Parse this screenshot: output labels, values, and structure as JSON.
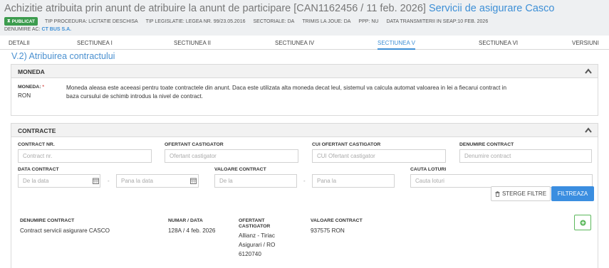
{
  "header": {
    "title_main": "Achizitie atribuita prin anunt de atribuire la anunt de participare [CAN1162456 / 11 feb. 2026]",
    "title_link": "Servicii de asigurare Casco",
    "badge": "PUBLICAT",
    "meta": [
      "TIP PROCEDURA: LICITATIE DESCHISA",
      "TIP LEGISLATIE: LEGEA NR. 99/23.05.2016",
      "SECTORIALE: DA",
      "TRIMIS LA JOUE: DA",
      "PPP: NU",
      "DATA TRANSMITERII IN SEAP:10 FEB. 2026"
    ],
    "denumire_label": "DENUMIRE AC:",
    "denumire_value": "CT BUS S.A."
  },
  "tabs": [
    "DETALII",
    "SECTIUNEA I",
    "SECTIUNEA II",
    "SECTIUNEA IV",
    "SECTIUNEA V",
    "SECTIUNEA VI",
    "VERSIUNI"
  ],
  "active_tab": "SECTIUNEA V",
  "section_title": "V.2) Atribuirea contractului",
  "moneda": {
    "title": "MONEDA",
    "label": "MONEDA:",
    "required_mark": "*",
    "value": "RON",
    "note": "Moneda aleasa este aceeasi pentru toate contractele din anunt. Daca este utilizata alta moneda decat leul, sistemul va calcula automat valoarea in lei a fiecarui contract in baza cursului de schimb introdus la nivel de contract."
  },
  "contracte": {
    "title": "CONTRACTE",
    "filters": {
      "contract_nr": {
        "label": "CONTRACT NR.",
        "placeholder": "Contract nr."
      },
      "ofertant": {
        "label": "OFERTANT CASTIGATOR",
        "placeholder": "Ofertant castigator"
      },
      "cui": {
        "label": "CUI OFERTANT CASTIGATOR",
        "placeholder": "CUI Ofertant castigator"
      },
      "denumire": {
        "label": "DENUMIRE CONTRACT",
        "placeholder": "Denumire contract"
      },
      "data": {
        "label": "DATA CONTRACT",
        "from_placeholder": "De la data",
        "to_placeholder": "Pana la data"
      },
      "valoare": {
        "label": "VALOARE CONTRACT",
        "from_placeholder": "De la",
        "to_placeholder": "Pana la"
      },
      "loturi": {
        "label": "CAUTA LOTURI",
        "placeholder": "Cauta loturi"
      },
      "separator": "-"
    },
    "buttons": {
      "clear": "STERGE FILTRE",
      "filter": "FILTREAZA"
    },
    "table": {
      "headers": {
        "denumire": "DENUMIRE CONTRACT",
        "numar": "NUMAR / DATA",
        "ofertant_l1": "OFERTANT",
        "ofertant_l2": "CASTIGATOR",
        "valoare": "VALOARE CONTRACT"
      },
      "row": {
        "denumire": "Contract servicii asigurare CASCO",
        "numar": "128A / 4 feb. 2026",
        "ofertant_lines": [
          "Allianz - Tiriac",
          "Asigurari / RO",
          "6120740"
        ],
        "valoare": "937575 RON"
      }
    }
  },
  "colors": {
    "accent": "#3d8fd6",
    "badge": "#3c9c4e",
    "button": "#3b8ee0",
    "expand": "#5cb85c"
  }
}
